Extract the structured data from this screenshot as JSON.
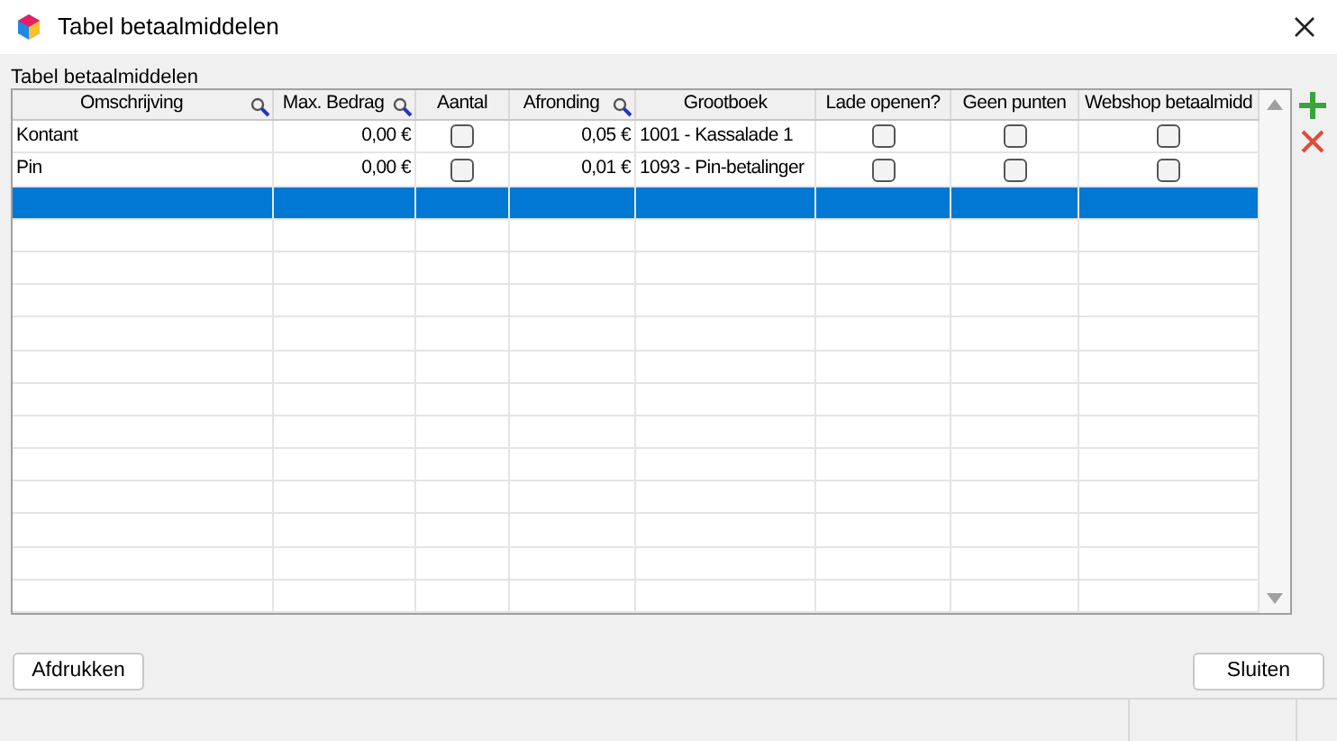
{
  "window": {
    "title": "Tabel betaalmiddelen"
  },
  "table": {
    "caption": "Tabel betaalmiddelen",
    "columns": [
      {
        "label": "Omschrijving",
        "searchable": true,
        "kind": "text"
      },
      {
        "label": "Max. Bedrag",
        "searchable": true,
        "kind": "number"
      },
      {
        "label": "Aantal",
        "searchable": false,
        "kind": "check"
      },
      {
        "label": "Afronding",
        "searchable": true,
        "kind": "number"
      },
      {
        "label": "Grootboek",
        "searchable": false,
        "kind": "text"
      },
      {
        "label": "Lade openen?",
        "searchable": false,
        "kind": "check"
      },
      {
        "label": "Geen punten",
        "searchable": false,
        "kind": "check"
      },
      {
        "label": "Webshop betaalmidd",
        "searchable": false,
        "kind": "check"
      }
    ],
    "rows": [
      {
        "selected": false,
        "cells": [
          "Kontant",
          "0,00 €",
          {
            "checked": false
          },
          "0,05 €",
          "1001 - Kassalade 1",
          {
            "checked": false
          },
          {
            "checked": false
          },
          {
            "checked": false
          }
        ]
      },
      {
        "selected": false,
        "cells": [
          "Pin",
          "0,00 €",
          {
            "checked": false
          },
          "0,01 €",
          "1093 - Pin-betalinger",
          {
            "checked": false
          },
          {
            "checked": false
          },
          {
            "checked": false
          }
        ]
      },
      {
        "selected": true
      }
    ]
  },
  "buttons": {
    "print": "Afdrukken",
    "close": "Sluiten"
  }
}
